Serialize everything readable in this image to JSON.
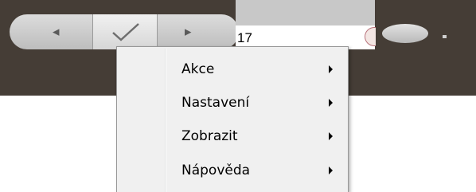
{
  "toolbar": {
    "back_icon": "left-arrow-icon",
    "confirm_icon": "checkmark-icon",
    "forward_icon": "right-arrow-icon",
    "field_value": "17"
  },
  "context_menu": {
    "items": [
      {
        "label": "Akce",
        "submenu_icon": "submenu-arrow-icon"
      },
      {
        "label": "Nastavení",
        "submenu_icon": "submenu-arrow-icon"
      },
      {
        "label": "Zobrazit",
        "submenu_icon": "submenu-arrow-icon"
      },
      {
        "label": "Nápověda",
        "submenu_icon": "submenu-arrow-icon"
      }
    ]
  },
  "colors": {
    "toolbar_bg": "#453d36",
    "menu_bg": "#f0f0f0",
    "menu_border": "#979797"
  }
}
